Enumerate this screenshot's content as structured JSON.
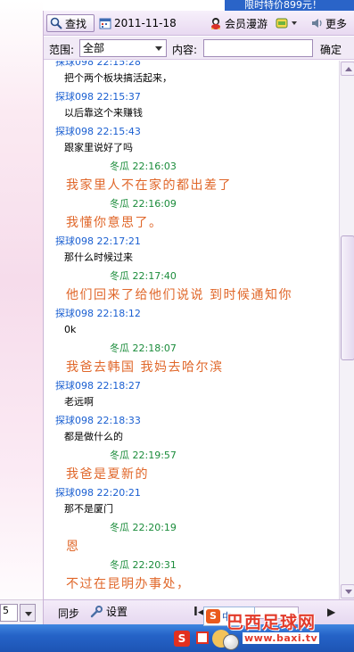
{
  "promo": {
    "text": "限时特价899元！"
  },
  "toolbar": {
    "search_label": "查找",
    "date": "2011-11-18",
    "member_label": "会员漫游",
    "more_label": "更多"
  },
  "filter": {
    "scope_label": "范围:",
    "scope_value": "全部",
    "content_label": "内容:",
    "content_value": "",
    "confirm_label": "确定"
  },
  "messages": [
    {
      "from": "friend",
      "sender": "探球098",
      "time": "22:15:28",
      "text": "把个两个板块搞活起来，"
    },
    {
      "from": "friend",
      "sender": "探球098",
      "time": "22:15:37",
      "text": "以后靠这个来赚钱"
    },
    {
      "from": "friend",
      "sender": "探球098",
      "time": "22:15:43",
      "text": "跟家里说好了吗"
    },
    {
      "from": "me",
      "sender": "冬瓜",
      "time": "22:16:03",
      "text": "我家里人不在家的都出差了"
    },
    {
      "from": "me",
      "sender": "冬瓜",
      "time": "22:16:09",
      "text": "我懂你意思了。"
    },
    {
      "from": "friend",
      "sender": "探球098",
      "time": "22:17:21",
      "text": "那什么时候过来"
    },
    {
      "from": "me",
      "sender": "冬瓜",
      "time": "22:17:40",
      "text": "他们回来了给他们说说 到时候通知你"
    },
    {
      "from": "friend",
      "sender": "探球098",
      "time": "22:18:12",
      "text": "0k"
    },
    {
      "from": "me",
      "sender": "冬瓜",
      "time": "22:18:07",
      "text": "我爸去韩国 我妈去哈尔滨"
    },
    {
      "from": "friend",
      "sender": "探球098",
      "time": "22:18:27",
      "text": "老远啊"
    },
    {
      "from": "friend",
      "sender": "探球098",
      "time": "22:18:33",
      "text": "都是做什么的"
    },
    {
      "from": "me",
      "sender": "冬瓜",
      "time": "22:19:57",
      "text": "我爸是夏新的"
    },
    {
      "from": "friend",
      "sender": "探球098",
      "time": "22:20:21",
      "text": "那不是厦门"
    },
    {
      "from": "me",
      "sender": "冬瓜",
      "time": "22:20:19",
      "text": "恩"
    },
    {
      "from": "me",
      "sender": "冬瓜",
      "time": "22:20:31",
      "text": "不过在昆明办事处，"
    }
  ],
  "bottom": {
    "sync_label": "同步",
    "settings_label": "设置",
    "nav_first": "I◀",
    "nav_next": "▶"
  },
  "left_fragment": {
    "text": "5"
  },
  "ime": {
    "mode": "中"
  },
  "watermark": {
    "title": "巴西足球网",
    "url": "www.baxi.tv"
  },
  "colors": {
    "friend_name": "#1a5fd1",
    "my_name": "#1b8c3b",
    "my_message": "#e0672a",
    "toolbar_bg": "#e8d9f1",
    "taskbar": "#2563c7"
  },
  "icons": [
    "search-icon",
    "calendar-icon",
    "member-avatar-icon",
    "emoji-icon",
    "speaker-icon",
    "wrench-icon",
    "sougou-icon"
  ]
}
